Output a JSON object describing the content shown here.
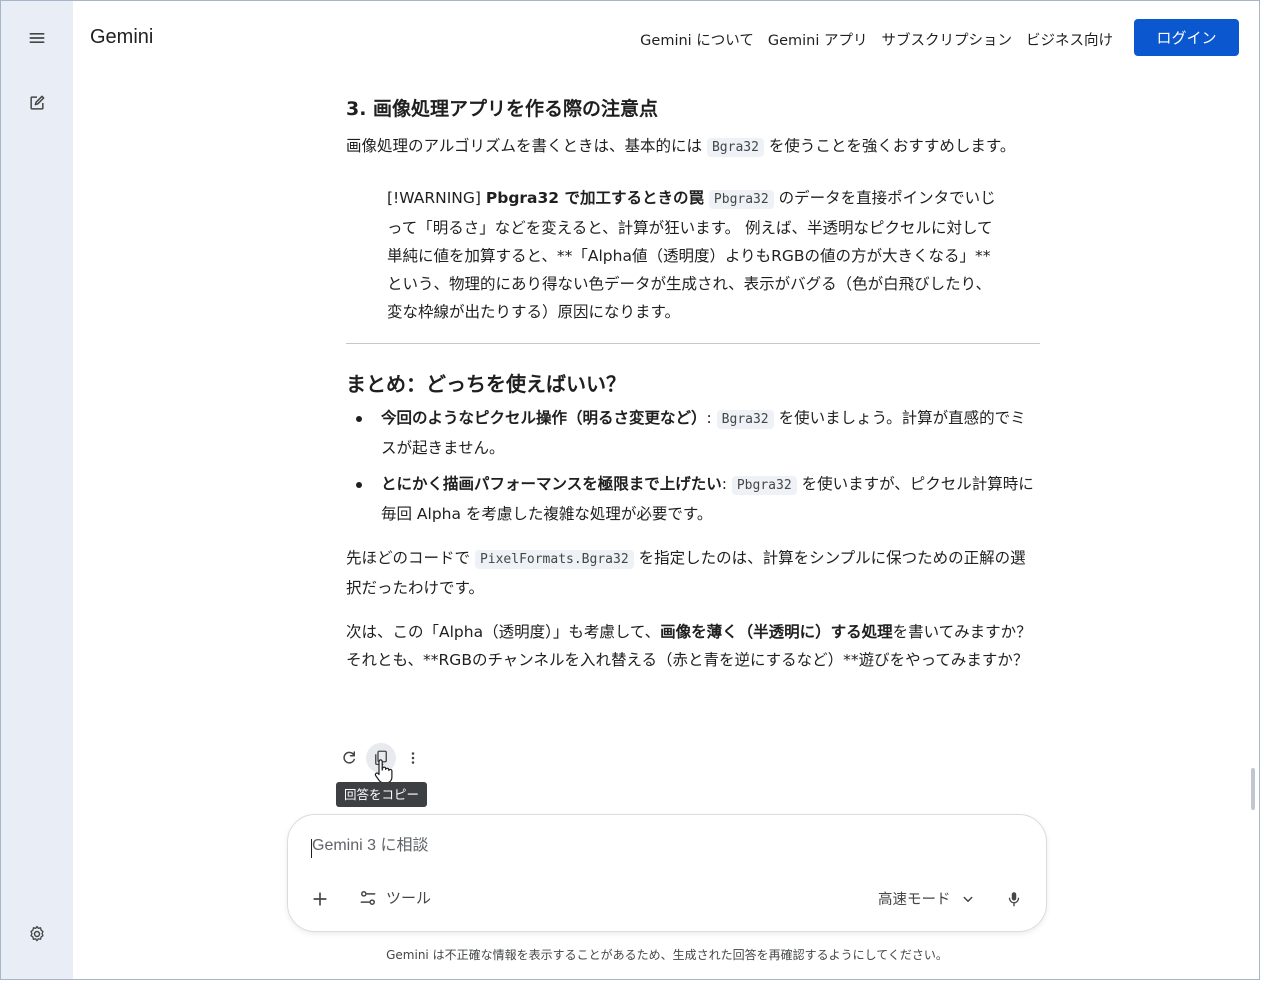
{
  "app": {
    "brand": "Gemini"
  },
  "nav": {
    "items": [
      "Gemini について",
      "Gemini アプリ",
      "サブスクリプション",
      "ビジネス向け"
    ],
    "login_label": "ログイン"
  },
  "rail": {
    "menu_icon": "menu-icon",
    "new_chat_icon": "edit-icon",
    "settings_icon": "gear-icon"
  },
  "content": {
    "section3_title": "3. 画像処理アプリを作る際の注意点",
    "section3_p1_before": "画像処理のアルゴリズムを書くときは、基本的には ",
    "section3_p1_code": "Bgra32",
    "section3_p1_after": " を使うことを強くおすすめします。",
    "warning_prefix": "[!WARNING] ",
    "warning_bold": "Pbgra32 で加工するときの罠",
    "warning_space": " ",
    "warning_code": "Pbgra32",
    "warning_after": " のデータを直接ポインタでいじって「明るさ」などを変えると、計算が狂います。 例えば、半透明なピクセルに対して単純に値を加算すると、**「Alpha値（透明度）よりもRGBの値の方が大きくなる」**という、物理的にあり得ない色データが生成され、表示がバグる（色が白飛びしたり、変な枠線が出たりする）原因になります。",
    "summary_title": "まとめ：どっちを使えばいい？",
    "bullets": [
      {
        "bold": "今回のようなピクセル操作（明るさ変更など）",
        "sep": ": ",
        "code": "Bgra32",
        "after": " を使いましょう。計算が直感的でミスが起きません。"
      },
      {
        "bold": "とにかく描画パフォーマンスを極限まで上げたい",
        "sep": ": ",
        "code": "Pbgra32",
        "after": " を使いますが、ピクセル計算時に毎回 Alpha を考慮した複雑な処理が必要です。"
      }
    ],
    "p2_before": "先ほどのコードで ",
    "p2_code": "PixelFormats.Bgra32",
    "p2_after": " を指定したのは、計算をシンプルに保つための正解の選択だったわけです。",
    "p3_before": "次は、この「Alpha（透明度）」も考慮して、",
    "p3_bold": "画像を薄く（半透明に）する処理",
    "p3_after": "を書いてみますか？それとも、**RGBのチャンネルを入れ替える（赤と青を逆にするなど）**遊びをやってみますか？"
  },
  "actions": {
    "regenerate_icon": "refresh-icon",
    "copy_icon": "copy-icon",
    "more_icon": "more-vert-icon",
    "copy_tooltip": "回答をコピー"
  },
  "composer": {
    "placeholder": "Gemini 3 に相談",
    "add_icon": "plus-icon",
    "tools_label": "ツール",
    "mode_label": "高速モード",
    "mic_icon": "mic-icon"
  },
  "footer": {
    "disclaimer": "Gemini は不正確な情報を表示することがあるため、生成された回答を再確認するようにしてください。"
  },
  "colors": {
    "rail_bg": "#e9eef6",
    "accent": "#0b57d0",
    "code_bg": "#eef2f7"
  }
}
